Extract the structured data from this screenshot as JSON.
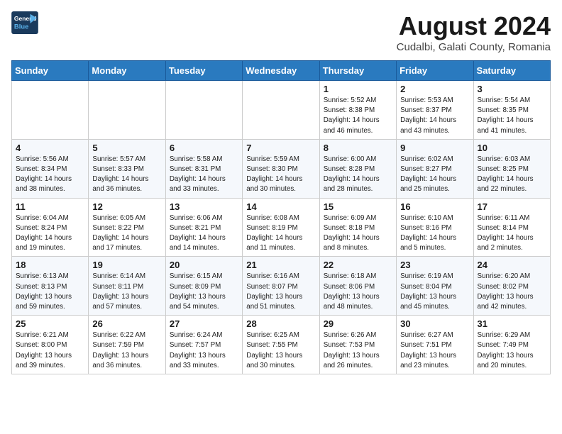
{
  "header": {
    "logo_line1": "General",
    "logo_line2": "Blue",
    "month_year": "August 2024",
    "location": "Cudalbi, Galati County, Romania"
  },
  "weekdays": [
    "Sunday",
    "Monday",
    "Tuesday",
    "Wednesday",
    "Thursday",
    "Friday",
    "Saturday"
  ],
  "weeks": [
    [
      {
        "day": "",
        "info": ""
      },
      {
        "day": "",
        "info": ""
      },
      {
        "day": "",
        "info": ""
      },
      {
        "day": "",
        "info": ""
      },
      {
        "day": "1",
        "info": "Sunrise: 5:52 AM\nSunset: 8:38 PM\nDaylight: 14 hours\nand 46 minutes."
      },
      {
        "day": "2",
        "info": "Sunrise: 5:53 AM\nSunset: 8:37 PM\nDaylight: 14 hours\nand 43 minutes."
      },
      {
        "day": "3",
        "info": "Sunrise: 5:54 AM\nSunset: 8:35 PM\nDaylight: 14 hours\nand 41 minutes."
      }
    ],
    [
      {
        "day": "4",
        "info": "Sunrise: 5:56 AM\nSunset: 8:34 PM\nDaylight: 14 hours\nand 38 minutes."
      },
      {
        "day": "5",
        "info": "Sunrise: 5:57 AM\nSunset: 8:33 PM\nDaylight: 14 hours\nand 36 minutes."
      },
      {
        "day": "6",
        "info": "Sunrise: 5:58 AM\nSunset: 8:31 PM\nDaylight: 14 hours\nand 33 minutes."
      },
      {
        "day": "7",
        "info": "Sunrise: 5:59 AM\nSunset: 8:30 PM\nDaylight: 14 hours\nand 30 minutes."
      },
      {
        "day": "8",
        "info": "Sunrise: 6:00 AM\nSunset: 8:28 PM\nDaylight: 14 hours\nand 28 minutes."
      },
      {
        "day": "9",
        "info": "Sunrise: 6:02 AM\nSunset: 8:27 PM\nDaylight: 14 hours\nand 25 minutes."
      },
      {
        "day": "10",
        "info": "Sunrise: 6:03 AM\nSunset: 8:25 PM\nDaylight: 14 hours\nand 22 minutes."
      }
    ],
    [
      {
        "day": "11",
        "info": "Sunrise: 6:04 AM\nSunset: 8:24 PM\nDaylight: 14 hours\nand 19 minutes."
      },
      {
        "day": "12",
        "info": "Sunrise: 6:05 AM\nSunset: 8:22 PM\nDaylight: 14 hours\nand 17 minutes."
      },
      {
        "day": "13",
        "info": "Sunrise: 6:06 AM\nSunset: 8:21 PM\nDaylight: 14 hours\nand 14 minutes."
      },
      {
        "day": "14",
        "info": "Sunrise: 6:08 AM\nSunset: 8:19 PM\nDaylight: 14 hours\nand 11 minutes."
      },
      {
        "day": "15",
        "info": "Sunrise: 6:09 AM\nSunset: 8:18 PM\nDaylight: 14 hours\nand 8 minutes."
      },
      {
        "day": "16",
        "info": "Sunrise: 6:10 AM\nSunset: 8:16 PM\nDaylight: 14 hours\nand 5 minutes."
      },
      {
        "day": "17",
        "info": "Sunrise: 6:11 AM\nSunset: 8:14 PM\nDaylight: 14 hours\nand 2 minutes."
      }
    ],
    [
      {
        "day": "18",
        "info": "Sunrise: 6:13 AM\nSunset: 8:13 PM\nDaylight: 13 hours\nand 59 minutes."
      },
      {
        "day": "19",
        "info": "Sunrise: 6:14 AM\nSunset: 8:11 PM\nDaylight: 13 hours\nand 57 minutes."
      },
      {
        "day": "20",
        "info": "Sunrise: 6:15 AM\nSunset: 8:09 PM\nDaylight: 13 hours\nand 54 minutes."
      },
      {
        "day": "21",
        "info": "Sunrise: 6:16 AM\nSunset: 8:07 PM\nDaylight: 13 hours\nand 51 minutes."
      },
      {
        "day": "22",
        "info": "Sunrise: 6:18 AM\nSunset: 8:06 PM\nDaylight: 13 hours\nand 48 minutes."
      },
      {
        "day": "23",
        "info": "Sunrise: 6:19 AM\nSunset: 8:04 PM\nDaylight: 13 hours\nand 45 minutes."
      },
      {
        "day": "24",
        "info": "Sunrise: 6:20 AM\nSunset: 8:02 PM\nDaylight: 13 hours\nand 42 minutes."
      }
    ],
    [
      {
        "day": "25",
        "info": "Sunrise: 6:21 AM\nSunset: 8:00 PM\nDaylight: 13 hours\nand 39 minutes."
      },
      {
        "day": "26",
        "info": "Sunrise: 6:22 AM\nSunset: 7:59 PM\nDaylight: 13 hours\nand 36 minutes."
      },
      {
        "day": "27",
        "info": "Sunrise: 6:24 AM\nSunset: 7:57 PM\nDaylight: 13 hours\nand 33 minutes."
      },
      {
        "day": "28",
        "info": "Sunrise: 6:25 AM\nSunset: 7:55 PM\nDaylight: 13 hours\nand 30 minutes."
      },
      {
        "day": "29",
        "info": "Sunrise: 6:26 AM\nSunset: 7:53 PM\nDaylight: 13 hours\nand 26 minutes."
      },
      {
        "day": "30",
        "info": "Sunrise: 6:27 AM\nSunset: 7:51 PM\nDaylight: 13 hours\nand 23 minutes."
      },
      {
        "day": "31",
        "info": "Sunrise: 6:29 AM\nSunset: 7:49 PM\nDaylight: 13 hours\nand 20 minutes."
      }
    ]
  ]
}
